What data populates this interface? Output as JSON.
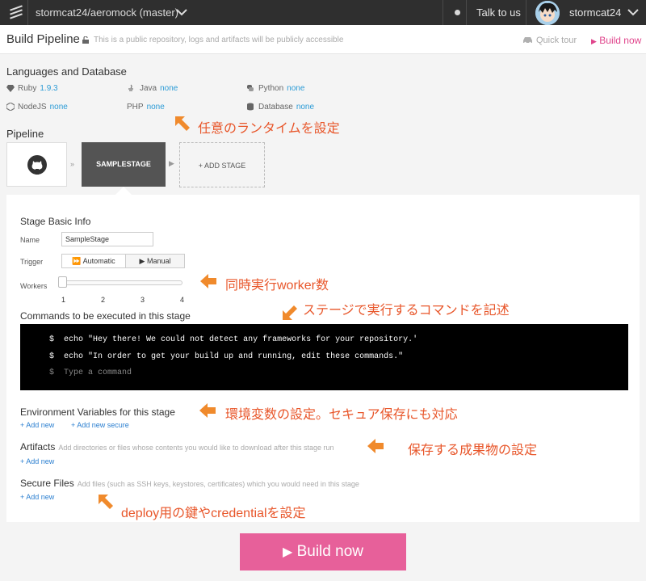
{
  "topnav": {
    "repo": "stormcat24/aeromock (master)",
    "talk": "Talk to us",
    "user": "stormcat24"
  },
  "header": {
    "title": "Build Pipeline",
    "note": "This is a public repository, logs and artifacts will be publicly accessible",
    "quick_tour": "Quick tour",
    "build_now": "Build now"
  },
  "languages": {
    "heading": "Languages and Database",
    "items": [
      {
        "name": "Ruby",
        "value": "1.9.3",
        "icon": "ruby-icon"
      },
      {
        "name": "Java",
        "value": "none",
        "icon": "java-icon"
      },
      {
        "name": "Python",
        "value": "none",
        "icon": "python-icon"
      },
      {
        "name": "NodeJS",
        "value": "none",
        "icon": "nodejs-icon"
      },
      {
        "name": "PHP",
        "value": "none",
        "icon": ""
      },
      {
        "name": "Database",
        "value": "none",
        "icon": "database-icon"
      }
    ]
  },
  "pipeline": {
    "heading": "Pipeline",
    "stage": "SAMPLESTAGE",
    "add_stage": "+ ADD STAGE"
  },
  "stage": {
    "heading": "Stage Basic Info",
    "name_label": "Name",
    "name_value": "SampleStage",
    "trigger_label": "Trigger",
    "trigger_auto": "Automatic",
    "trigger_manual": "Manual",
    "trigger_selected": "Automatic",
    "workers_label": "Workers",
    "workers_ticks": [
      "1",
      "2",
      "3",
      "4"
    ],
    "workers_value": 1
  },
  "commands": {
    "heading": "Commands to be executed in this stage",
    "prompt": "$",
    "lines": [
      "echo \"Hey there! We could not detect any frameworks for your repository.'",
      "echo \"In order to get your build up and running, edit these commands.\""
    ],
    "placeholder": "Type a command"
  },
  "env": {
    "heading": "Environment Variables for this stage",
    "add_new": "+ Add new",
    "add_secure": "+ Add new secure"
  },
  "artifacts": {
    "heading": "Artifacts",
    "hint": "Add directories or files whose contents you would like to download after this stage run",
    "add_new": "+ Add new"
  },
  "secure_files": {
    "heading": "Secure Files",
    "hint": "Add files (such as SSH keys, keystores, certificates) which you would need in this stage",
    "add_new": "+ Add new"
  },
  "footer": {
    "build_now": "Build now"
  },
  "annotations": {
    "runtime": "任意のランタイムを設定",
    "workers": "同時実行worker数",
    "commands": "ステージで実行するコマンドを記述",
    "env": "環境変数の設定。セキュア保存にも対応",
    "artifacts": "保存する成果物の設定",
    "secure": "deploy用の鍵やcredentialを設定"
  },
  "colors": {
    "accent": "#e7609a",
    "link": "#2b7fd0",
    "annotation": "#e8562a"
  }
}
